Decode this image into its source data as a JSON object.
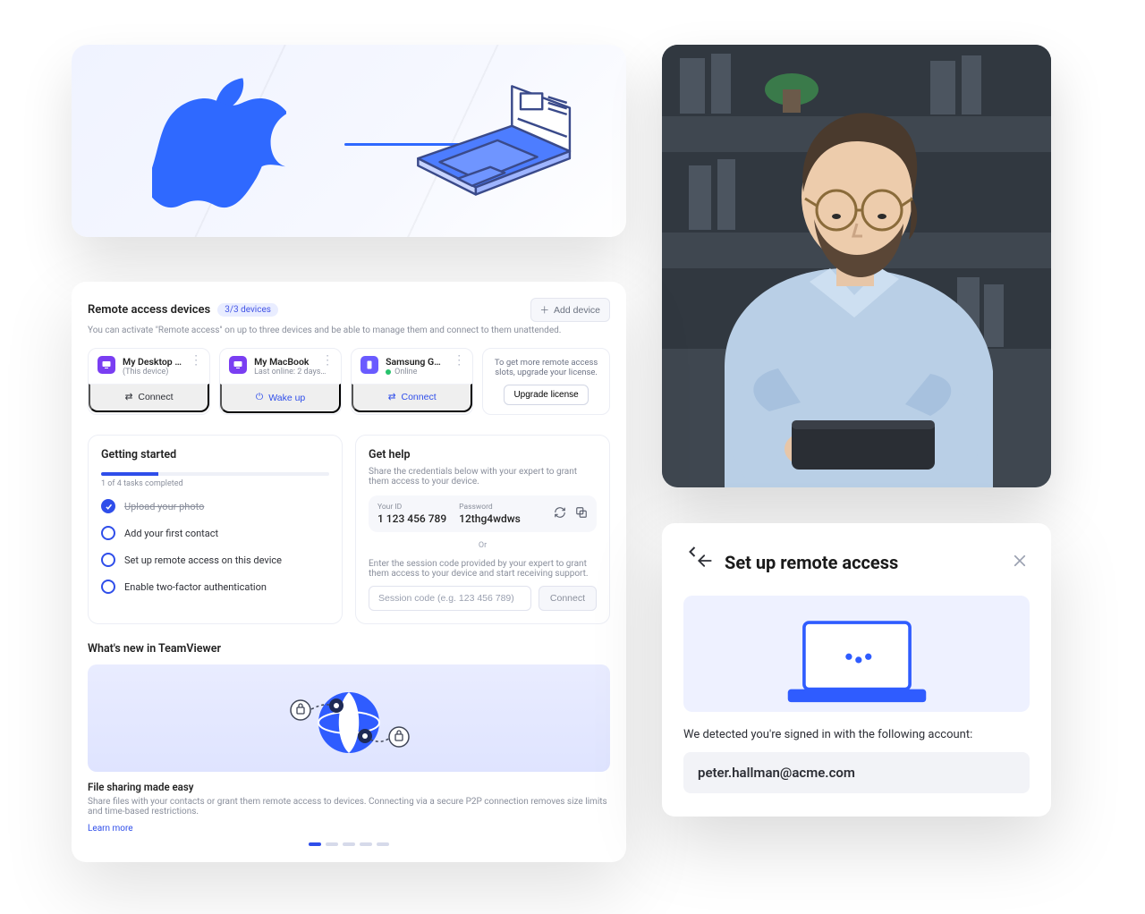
{
  "hero": {
    "logo_name": "apple-logo"
  },
  "dashboard": {
    "title": "Remote access devices",
    "badge": "3/3 devices",
    "subtitle": "You can activate \"Remote access\" on up to three devices and be able to manage them and connect to them unattended.",
    "add_device_label": "Add device",
    "devices": [
      {
        "name": "My Desktop PC",
        "sub": "(This device)",
        "action": "Connect",
        "action_style": "default"
      },
      {
        "name": "My MacBook",
        "sub": "Last online: 2 days…",
        "action": "Wake up",
        "action_style": "blue"
      },
      {
        "name": "Samsung Galaxy…",
        "sub": "Online",
        "online": true,
        "action": "Connect",
        "action_style": "blue"
      }
    ],
    "upgrade": {
      "text": "To get more remote access slots, upgrade your license.",
      "button": "Upgrade license"
    },
    "getting_started": {
      "title": "Getting started",
      "progress_caption": "1 of 4 tasks completed",
      "tasks": [
        {
          "label": "Upload your photo",
          "done": true
        },
        {
          "label": "Add your first contact",
          "done": false
        },
        {
          "label": "Set up remote access on this device",
          "done": false
        },
        {
          "label": "Enable two-factor authentication",
          "done": false
        }
      ]
    },
    "get_help": {
      "title": "Get help",
      "subtitle": "Share the credentials below with your expert to grant them access to your device.",
      "id_label": "Your ID",
      "id_value": "1 123 456 789",
      "pw_label": "Password",
      "pw_value": "12thg4wdws",
      "or": "Or",
      "enter_help": "Enter the session code provided by your expert to grant them access to your device and start receiving support.",
      "session_placeholder": "Session code (e.g. 123 456 789)",
      "connect_label": "Connect"
    },
    "news": {
      "section_title": "What's new in TeamViewer",
      "headline": "File sharing made easy",
      "body": "Share files with your contacts or grant them remote access to devices. Connecting via a secure P2P connection removes size limits and time-based restrictions.",
      "learn_more": "Learn more"
    }
  },
  "setup": {
    "title": "Set up remote access",
    "detected_text": "We detected you're signed in with the following account:",
    "email": "peter.hallman@acme.com"
  }
}
